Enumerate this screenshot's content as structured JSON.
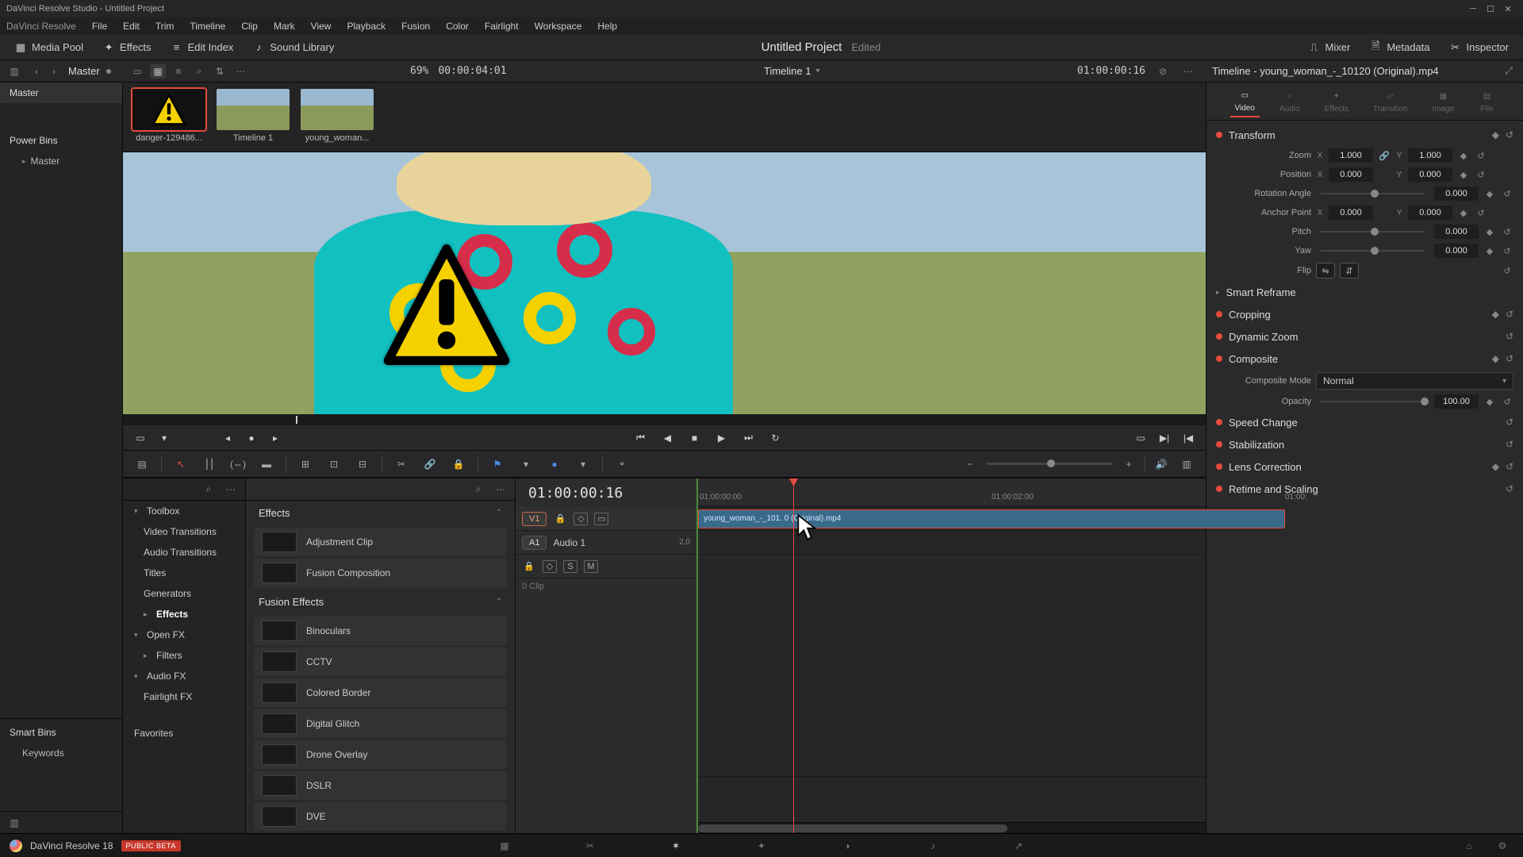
{
  "window_title": "DaVinci Resolve Studio - Untitled Project",
  "menu": {
    "app": "DaVinci Resolve",
    "items": [
      "File",
      "Edit",
      "Trim",
      "Timeline",
      "Clip",
      "Mark",
      "View",
      "Playback",
      "Fusion",
      "Color",
      "Fairlight",
      "Workspace",
      "Help"
    ]
  },
  "toolbar": {
    "media_pool": "Media Pool",
    "effects": "Effects",
    "edit_index": "Edit Index",
    "sound_library": "Sound Library",
    "project_title": "Untitled Project",
    "project_status": "Edited",
    "mixer": "Mixer",
    "metadata": "Metadata",
    "inspector": "Inspector"
  },
  "secbar": {
    "master": "Master",
    "zoom_pct": "69%",
    "source_tc": "00:00:04:01",
    "timeline_label": "Timeline 1",
    "record_tc": "01:00:00:16"
  },
  "bins": {
    "tab": "Master",
    "power": "Power Bins",
    "power_items": [
      "Master"
    ],
    "smart": "Smart Bins",
    "smart_items": [
      "Keywords"
    ]
  },
  "media": {
    "clips": [
      {
        "label": "danger-129486...",
        "kind": "warning"
      },
      {
        "label": "Timeline 1",
        "kind": "timeline"
      },
      {
        "label": "young_woman...",
        "kind": "video"
      }
    ]
  },
  "fx_nav": {
    "toolbox": "Toolbox",
    "toolbox_items": [
      "Video Transitions",
      "Audio Transitions",
      "Titles",
      "Generators",
      "Effects"
    ],
    "openfx": "Open FX",
    "openfx_items": [
      "Filters"
    ],
    "audiofx": "Audio FX",
    "audiofx_items": [
      "Fairlight FX"
    ],
    "favorites": "Favorites"
  },
  "fx_list": {
    "group_effects": "Effects",
    "effects_items": [
      "Adjustment Clip",
      "Fusion Composition"
    ],
    "group_fusion": "Fusion Effects",
    "fusion_items": [
      "Binoculars",
      "CCTV",
      "Colored Border",
      "Digital Glitch",
      "Drone Overlay",
      "DSLR",
      "DVE"
    ]
  },
  "timeline": {
    "tc": "01:00:00:16",
    "ruler": [
      "01:00:00:00",
      "01:00:02:00",
      "01:00:"
    ],
    "v1": "V1",
    "a1": "A1",
    "audio_label": "Audio 1",
    "audio_ch": "2.0",
    "clip_name": "young_woman_-_101. 0 (Original).mp4",
    "zero_clip": "0 Clip",
    "solo": "S",
    "mute": "M"
  },
  "inspector": {
    "title": "Timeline - young_woman_-_10120 (Original).mp4",
    "tabs": [
      "Video",
      "Audio",
      "Effects",
      "Transition",
      "Image",
      "File"
    ],
    "transform": "Transform",
    "zoom": "Zoom",
    "zoom_x": "1.000",
    "zoom_y": "1.000",
    "position": "Position",
    "pos_x": "0.000",
    "pos_y": "0.000",
    "rotation": "Rotation Angle",
    "rot_v": "0.000",
    "anchor": "Anchor Point",
    "anc_x": "0.000",
    "anc_y": "0.000",
    "pitch": "Pitch",
    "pitch_v": "0.000",
    "yaw": "Yaw",
    "yaw_v": "0.000",
    "flip": "Flip",
    "smart_reframe": "Smart Reframe",
    "cropping": "Cropping",
    "dynamic_zoom": "Dynamic Zoom",
    "composite": "Composite",
    "composite_mode_lbl": "Composite Mode",
    "composite_mode": "Normal",
    "opacity_lbl": "Opacity",
    "opacity": "100.00",
    "speed": "Speed Change",
    "stabilization": "Stabilization",
    "lens": "Lens Correction",
    "retime": "Retime and Scaling"
  },
  "pagebar": {
    "app": "DaVinci Resolve 18",
    "beta": "PUBLIC BETA"
  }
}
